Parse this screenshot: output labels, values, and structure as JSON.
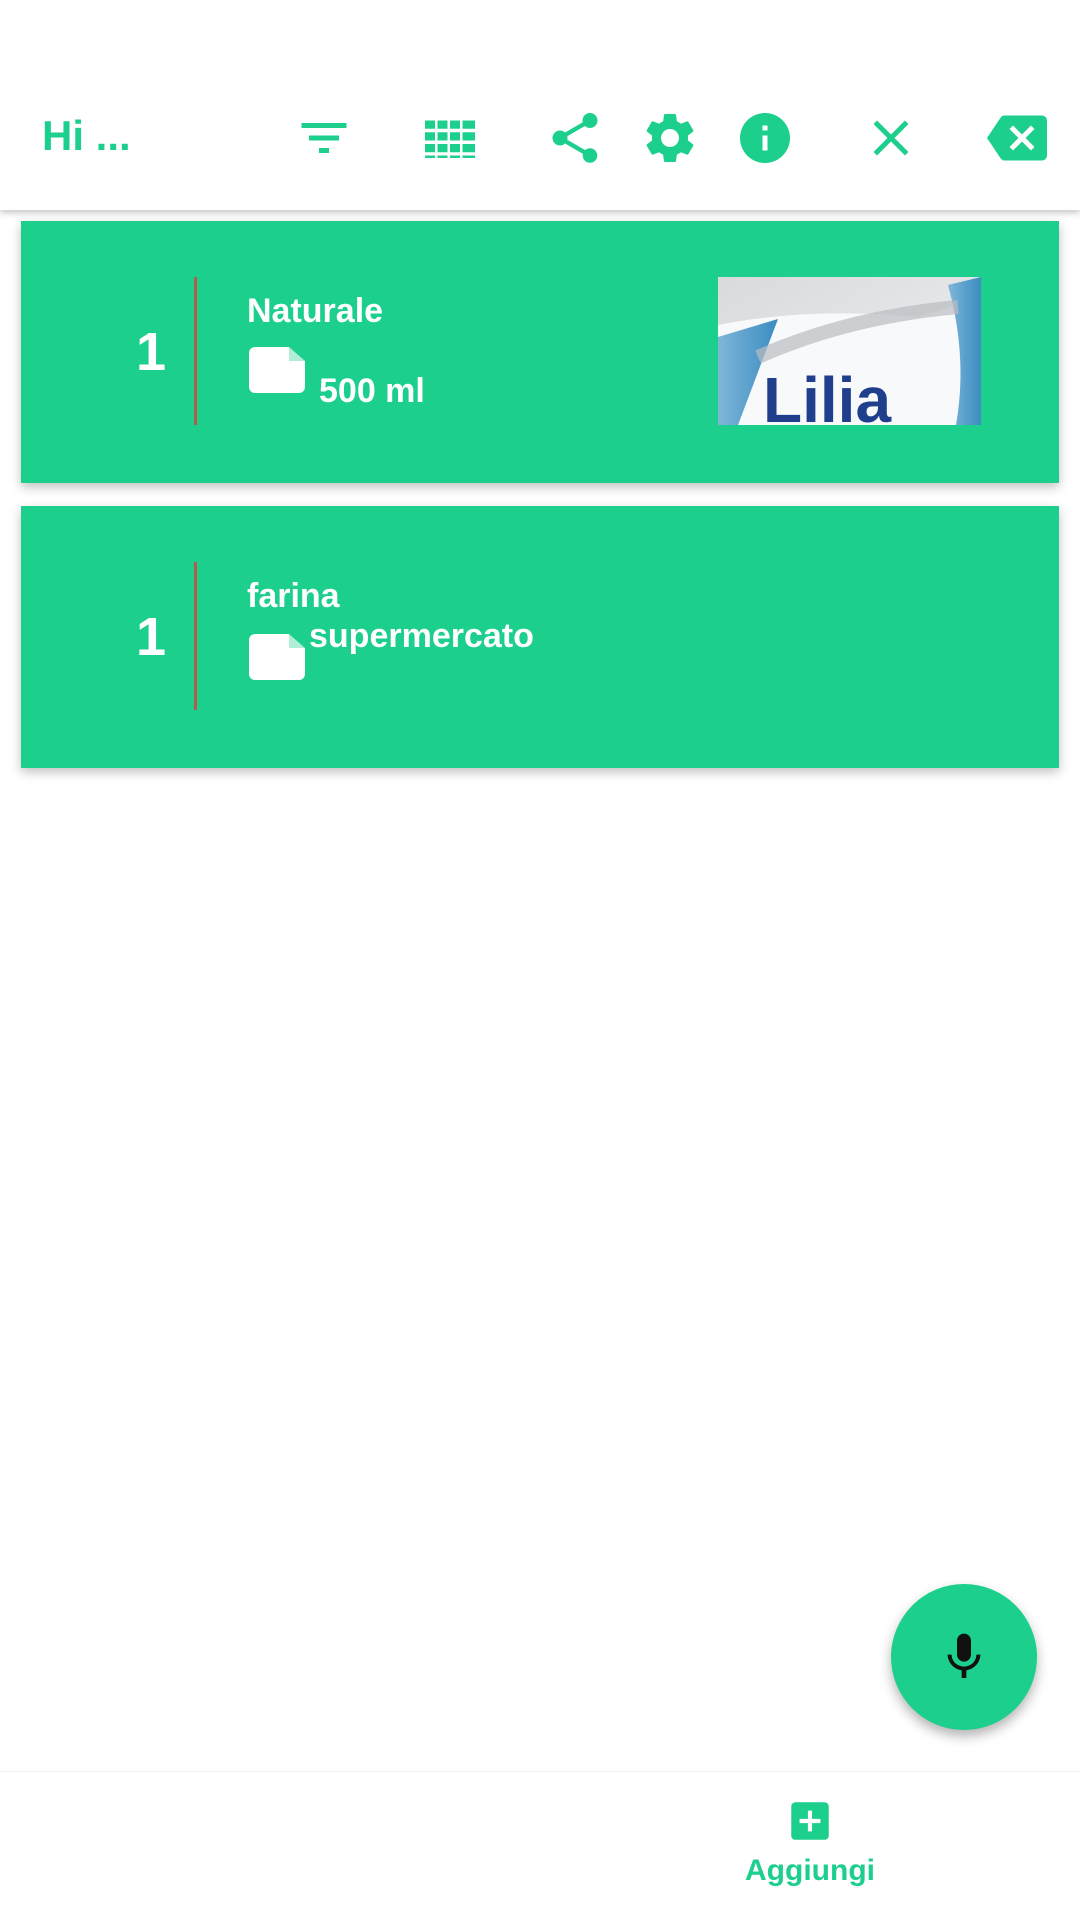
{
  "colors": {
    "accent": "#1ccf8c",
    "divider": "#b25c4e",
    "on_accent": "#ffffff"
  },
  "app_bar": {
    "title": "Hi ...",
    "icons": [
      "filter-icon",
      "grid-icon",
      "share-icon",
      "settings-icon",
      "info-icon",
      "close-icon",
      "backspace-icon"
    ]
  },
  "items": [
    {
      "quantity": "1",
      "name": "Naturale",
      "note": "500 ml",
      "has_image": true,
      "image_text": "Lilia"
    },
    {
      "quantity": "1",
      "name": "farina",
      "note": "supermercato",
      "has_image": false
    }
  ],
  "fab": {
    "icon": "microphone-icon"
  },
  "bottom_nav": {
    "add_label": "Aggiungi",
    "add_icon": "plus-box-icon"
  }
}
